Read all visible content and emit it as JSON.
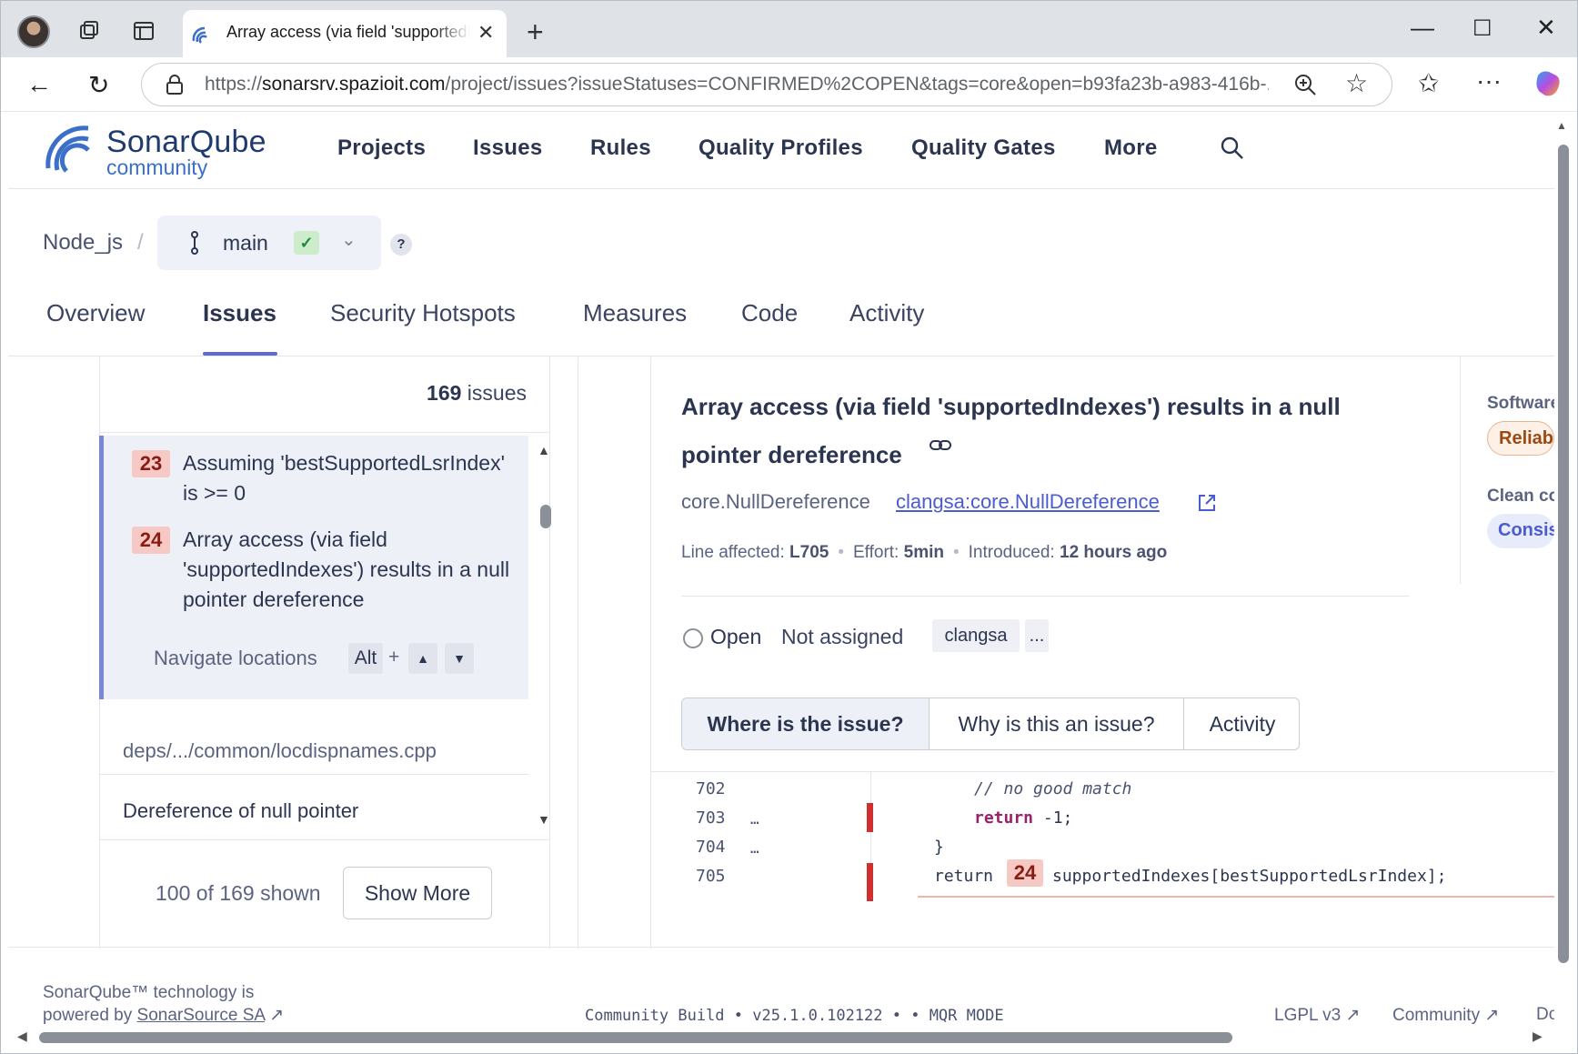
{
  "browser": {
    "tab_title": "Array access (via field 'supportedIndexes') results in a null pointer dereference",
    "tab_close": "✕",
    "new_tab": "+",
    "url_prefix": "https://",
    "url_host": "sonarsrv.spazioit.com",
    "url_rest": "/project/issues?issueStatuses=CONFIRMED%2COPEN&tags=core&open=b93fa23b-a983-416b-...",
    "window": {
      "minimize": "—",
      "maximize": "☐",
      "close": "✕"
    }
  },
  "header": {
    "logo_name": "SonarQube",
    "logo_sub": "community",
    "nav": [
      "Projects",
      "Issues",
      "Rules",
      "Quality Profiles",
      "Quality Gates",
      "More"
    ]
  },
  "project": {
    "name": "Node_js",
    "separator": "/",
    "branch": "main",
    "branch_status": "✓",
    "help": "?"
  },
  "subnav": [
    "Overview",
    "Issues",
    "Security Hotspots",
    "Measures",
    "Code",
    "Activity"
  ],
  "issue_list": {
    "count": "169",
    "count_label": "issues",
    "locations": [
      {
        "num": "23",
        "text": "Assuming 'bestSupportedLsrIndex' is >= 0"
      },
      {
        "num": "24",
        "text": "Array access (via field 'supportedIndexes') results in a null pointer dereference"
      }
    ],
    "navigate_label": "Navigate locations",
    "key_alt": "Alt",
    "key_plus": "+",
    "file_path": "deps/.../common/locdispnames.cpp",
    "next_issue": "Dereference of null pointer",
    "shown": "100 of 169 shown",
    "show_more": "Show More"
  },
  "issue": {
    "title": "Array access (via field 'supportedIndexes') results in a null pointer dereference",
    "rule_key": "core.NullDereference",
    "rule_link": "clangsa:core.NullDereference",
    "line_label": "Line affected:",
    "line_value": "L705",
    "effort_label": "Effort:",
    "effort_value": "5min",
    "introduced_label": "Introduced:",
    "introduced_value": "12 hours ago",
    "status": "Open",
    "assignee": "Not assigned",
    "tag": "clangsa",
    "more_tags": "...",
    "tabs": [
      "Where is the issue?",
      "Why is this an issue?",
      "Activity"
    ],
    "side_software_label": "Software",
    "side_reliability": "Reliability",
    "side_clean_label": "Clean code",
    "side_consistency": "Consistency"
  },
  "code": {
    "lines": [
      {
        "num": "702",
        "dots": "",
        "text": "// no good match"
      },
      {
        "num": "703",
        "dots": "…",
        "kw": "return",
        "text": " -1;"
      },
      {
        "num": "704",
        "dots": "…",
        "text": "}"
      },
      {
        "num": "705",
        "dots": "",
        "kw": "return",
        "loc": "24",
        "text": "supportedIndexes[bestSupportedLsrIndex];"
      }
    ]
  },
  "footer": {
    "line1": "SonarQube™ technology is",
    "line2_prefix": "powered by",
    "link": "SonarSource SA",
    "build": "Community Build • v25.1.0.102122 • • MQR MODE",
    "license": "LGPL v3",
    "community": "Community",
    "docs": "Documentation"
  }
}
